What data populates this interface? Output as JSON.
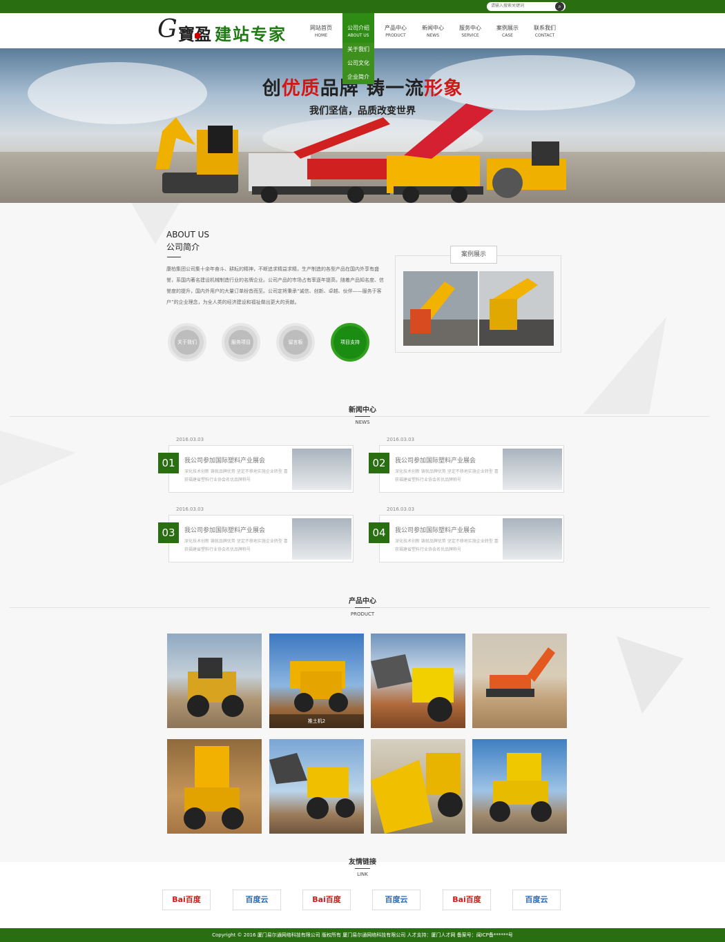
{
  "search": {
    "placeholder": "请输入搜索关键词",
    "icon": "search-icon"
  },
  "logo": {
    "g": "G",
    "mark": "寶盈",
    "text": "建站专家"
  },
  "nav": [
    {
      "cn": "网站首页",
      "en": "HOME"
    },
    {
      "cn": "公司介绍",
      "en": "ABOUT US"
    },
    {
      "cn": "产品中心",
      "en": "PRODUCT"
    },
    {
      "cn": "新闻中心",
      "en": "NEWS"
    },
    {
      "cn": "服务中心",
      "en": "SERVICE"
    },
    {
      "cn": "案例展示",
      "en": "CASE"
    },
    {
      "cn": "联系我们",
      "en": "CONTACT"
    }
  ],
  "dropdown": [
    "关于我们",
    "公司文化",
    "企业简介"
  ],
  "banner": {
    "title_a": "创",
    "title_b": "优质",
    "title_c": "品牌 铸一流",
    "title_d": "形象",
    "subtitle": "我们坚信，品质改变世界"
  },
  "about": {
    "en": "ABOUT US",
    "cn": "公司简介",
    "text": "康柏集团公司集十余年奋斗、耕耘的精神，不断追求精益求精，生产制造的各型产品在国内外享有盛誉，系国内著名建设机械制造行业的名牌企业。公司产品的市场占有率逐年提高，随着产品知名度、信誉度的提升，国内外用户的大量订单纷沓而至。公司定将秉承“诚信、创新、卓越、伙伴——服务于客户”的企业理念，为全人类的经济建设和福祉做出更大的贡献。",
    "buttons": [
      "关于我们",
      "服务项目",
      "留言板",
      "项目支持"
    ],
    "case_label": "案例展示"
  },
  "news_section": {
    "title": "新闻中心",
    "sub": "NEWS"
  },
  "news": [
    {
      "date": "2016.03.03",
      "num": "01",
      "title": "我公司参加国际塑料产业展会",
      "desc": "深化技术创新 铸就品牌优势 坚定不移地实施企业转型 喜获福建省塑料行业协会名优品牌称号"
    },
    {
      "date": "2016.03.03",
      "num": "02",
      "title": "我公司参加国际塑料产业展会",
      "desc": "深化技术创新 铸就品牌优势 坚定不移地实施企业转型 喜获福建省塑料行业协会名优品牌称号"
    },
    {
      "date": "2016.03.03",
      "num": "03",
      "title": "我公司参加国际塑料产业展会",
      "desc": "深化技术创新 铸就品牌优势 坚定不移地实施企业转型 喜获福建省塑料行业协会名优品牌称号"
    },
    {
      "date": "2016.03.03",
      "num": "04",
      "title": "我公司参加国际塑料产业展会",
      "desc": "深化技术创新 铸就品牌优势 坚定不移地实施企业转型 喜获福建省塑料行业协会名优品牌称号"
    }
  ],
  "product_section": {
    "title": "产品中心",
    "sub": "PRODUCT",
    "caption": "推土机2"
  },
  "links_section": {
    "title": "友情链接",
    "sub": "LINK"
  },
  "links": [
    {
      "label": "Bai百度",
      "type": "baidu"
    },
    {
      "label": "百度云",
      "type": "cloud"
    },
    {
      "label": "Bai百度",
      "type": "baidu"
    },
    {
      "label": "百度云",
      "type": "cloud"
    },
    {
      "label": "Bai百度",
      "type": "baidu"
    },
    {
      "label": "百度云",
      "type": "cloud"
    }
  ],
  "footer": "Copyright © 2016 厦门易尔通网络科技有限公司 版权所有 厦门易尔通网络科技有限公司 人才支持：厦门人才网 备案号：闽ICP备******号",
  "colors": {
    "brand_green": "#2a6e12",
    "accent_red": "#d01818"
  }
}
